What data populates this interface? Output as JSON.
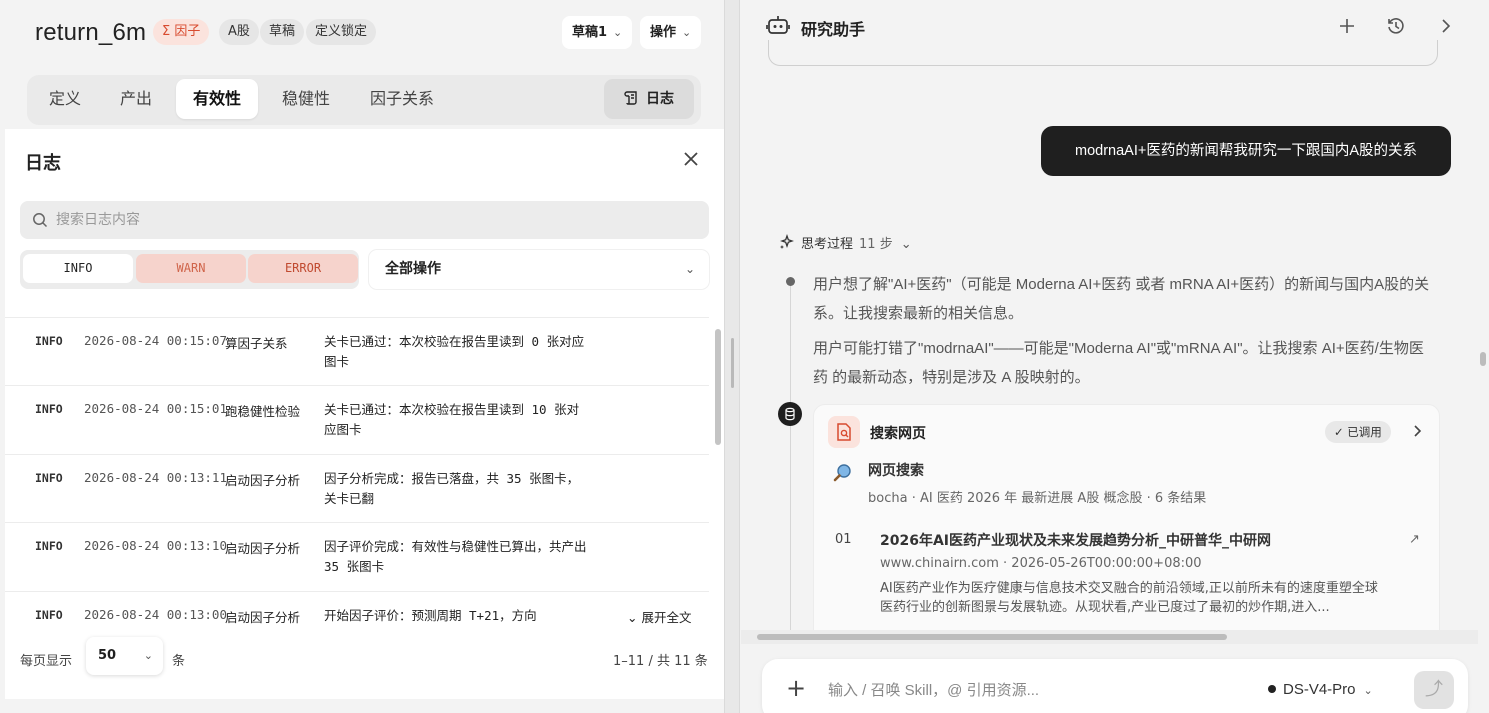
{
  "factor": {
    "name": "return_6m",
    "tags": [
      "Σ 因子",
      "A股",
      "草稿",
      "定义锁定"
    ],
    "draft_select": "草稿1",
    "actions_select": "操作"
  },
  "tabs": [
    {
      "label": "定义"
    },
    {
      "label": "产出"
    },
    {
      "label": "有效性"
    },
    {
      "label": "稳健性"
    },
    {
      "label": "因子关系"
    }
  ],
  "log_button": "日志",
  "log_panel": {
    "title": "日志",
    "search_placeholder": "搜索日志内容",
    "levels": [
      "INFO",
      "WARN",
      "ERROR"
    ],
    "operation_filter": "全部操作",
    "rows": [
      {
        "level": "INFO",
        "time": "2026-08-24 00:15:07",
        "op": "算因子关系",
        "msg": "关卡已通过：本次校验在报告里读到 0 张对应图卡"
      },
      {
        "level": "INFO",
        "time": "2026-08-24 00:15:01",
        "op": "跑稳健性检验",
        "msg": "关卡已通过：本次校验在报告里读到 10 张对应图卡"
      },
      {
        "level": "INFO",
        "time": "2026-08-24 00:13:11",
        "op": "启动因子分析",
        "msg": "因子分析完成：报告已落盘，共 35 张图卡，关卡已翻"
      },
      {
        "level": "INFO",
        "time": "2026-08-24 00:13:10",
        "op": "启动因子分析",
        "msg": "因子评价完成：有效性与稳健性已算出，共产出 35 张图卡"
      },
      {
        "level": "INFO",
        "time": "2026-08-24 00:13:00",
        "op": "启动因子分析",
        "msg": "开始因子评价：预测周期 T+21，方向"
      }
    ],
    "expand_label": "展开全文",
    "page_size_label": "每页显示",
    "page_size": "50",
    "page_size_unit": "条",
    "range": "1–11 / 共 11 条"
  },
  "assistant": {
    "title": "研究助手",
    "user_message": "modrnaAI+医药的新闻帮我研究一下跟国内A股的关系",
    "thinking_label": "思考过程",
    "thinking_steps": "11 步",
    "paragraph1": "用户想了解\"AI+医药\"（可能是 Moderna AI+医药 或者 mRNA AI+医药）的新闻与国内A股的关系。让我搜索最新的相关信息。",
    "paragraph2": "用户可能打错了\"modrnaAI\"——可能是\"Moderna AI\"或\"mRNA AI\"。让我搜索 AI+医药/生物医药 的最新动态，特别是涉及 A 股映射的。",
    "tool": {
      "title": "搜索网页",
      "status": "已调用",
      "search_name": "网页搜索",
      "search_meta": "bocha · AI 医药 2026 年 最新进展 A股 概念股 · 6 条结果",
      "result": {
        "index": "01",
        "title": "2026年AI医药产业现状及未来发展趋势分析_中研普华_中研网",
        "url": "www.chinairn.com · 2026-05-26T00:00:00+08:00",
        "snippet": "AI医药产业作为医疗健康与信息技术交叉融合的前沿领域,正以前所未有的速度重塑全球医药行业的创新图景与发展轨迹。从现状看,产业已度过了最初的炒作期,进入..."
      }
    },
    "composer_placeholder": "输入 / 召唤 Skill，@ 引用资源...",
    "model": "DS-V4-Pro"
  }
}
